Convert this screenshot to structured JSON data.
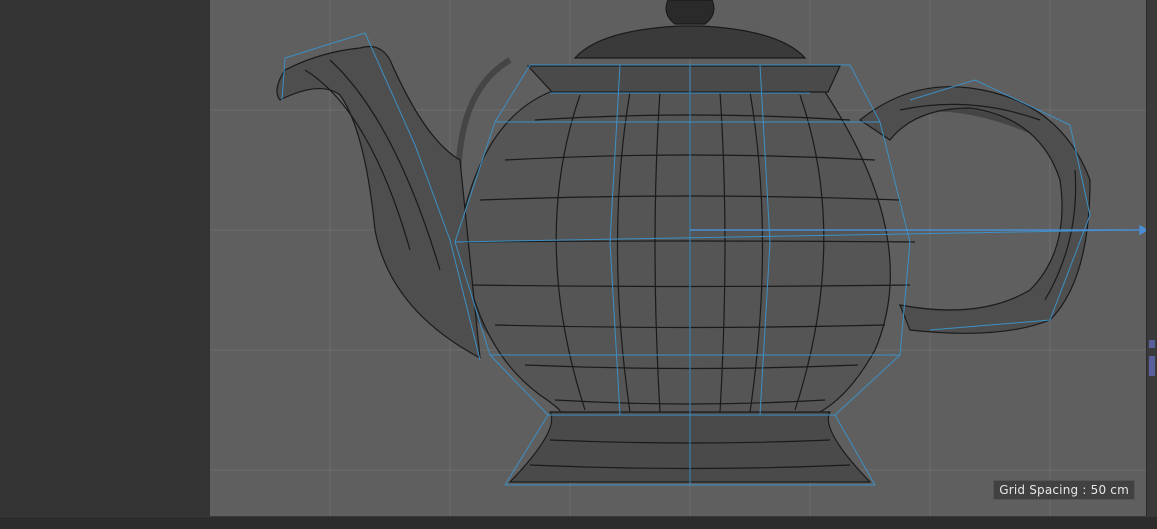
{
  "viewport": {
    "grid_spacing_label": "Grid Spacing : 50 cm",
    "colors": {
      "background": "#5f5f5f",
      "grid": "#6d6d6d",
      "wire": "#1a1a1a",
      "cage": "#3d8fc4",
      "axis": "#4a8fd4"
    }
  },
  "panels": {
    "left_panel_color": "#333333",
    "ruler_color": "#2c2c2c"
  }
}
